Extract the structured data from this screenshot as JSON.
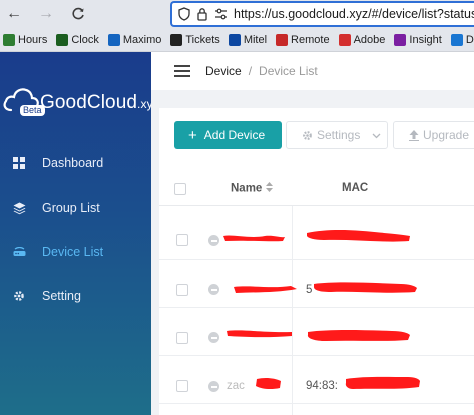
{
  "browser": {
    "url": "https://us.goodcloud.xyz/#/device/list?status=d",
    "bookmarks": [
      {
        "label": "Hours",
        "icon": "hours-bookmark-icon",
        "color": "#2e7d32"
      },
      {
        "label": "Clock",
        "icon": "clock-bookmark-icon",
        "color": "#1b5e20"
      },
      {
        "label": "Maximo",
        "icon": "maximo-bookmark-icon",
        "color": "#1565c0"
      },
      {
        "label": "Tickets",
        "icon": "tickets-bookmark-icon",
        "color": "#222222"
      },
      {
        "label": "Mitel",
        "icon": "mitel-bookmark-icon",
        "color": "#0d47a1"
      },
      {
        "label": "Remote",
        "icon": "remote-bookmark-icon",
        "color": "#c62828"
      },
      {
        "label": "Adobe",
        "icon": "adobe-bookmark-icon",
        "color": "#d32f2f"
      },
      {
        "label": "Insight",
        "icon": "insight-bookmark-icon",
        "color": "#7b1fa2"
      },
      {
        "label": "Dell",
        "icon": "dell-bookmark-icon",
        "color": "#1976d2"
      }
    ]
  },
  "app": {
    "logo": {
      "beta": "Beta",
      "name": "GoodCloud",
      "suffix": ".xyz"
    },
    "sidebar": {
      "items": [
        {
          "label": "Dashboard",
          "icon": "dashboard-icon",
          "active": false
        },
        {
          "label": "Group List",
          "icon": "layers-icon",
          "active": false
        },
        {
          "label": "Device List",
          "icon": "device-icon",
          "active": true
        },
        {
          "label": "Setting",
          "icon": "gear-icon",
          "active": false
        }
      ]
    },
    "breadcrumb": {
      "first": "Device",
      "separator": "/",
      "second": "Device List"
    },
    "toolbar": {
      "add_label": "Add Device",
      "settings_label": "Settings",
      "upgrade_label": "Upgrade"
    },
    "table": {
      "columns": {
        "name": "Name",
        "mac": "MAC"
      },
      "rows": [
        {
          "name": "",
          "mac": ""
        },
        {
          "name": "",
          "mac": "5"
        },
        {
          "name": "",
          "mac": ""
        },
        {
          "name": "zac",
          "mac": "94:83:"
        }
      ]
    },
    "colors": {
      "accent": "#19a0a6",
      "active_menu": "#5ab8f2",
      "sidebar_top": "#1a3c8c",
      "sidebar_bottom": "#1e6e8a",
      "redaction": "#ff1a1a"
    }
  }
}
